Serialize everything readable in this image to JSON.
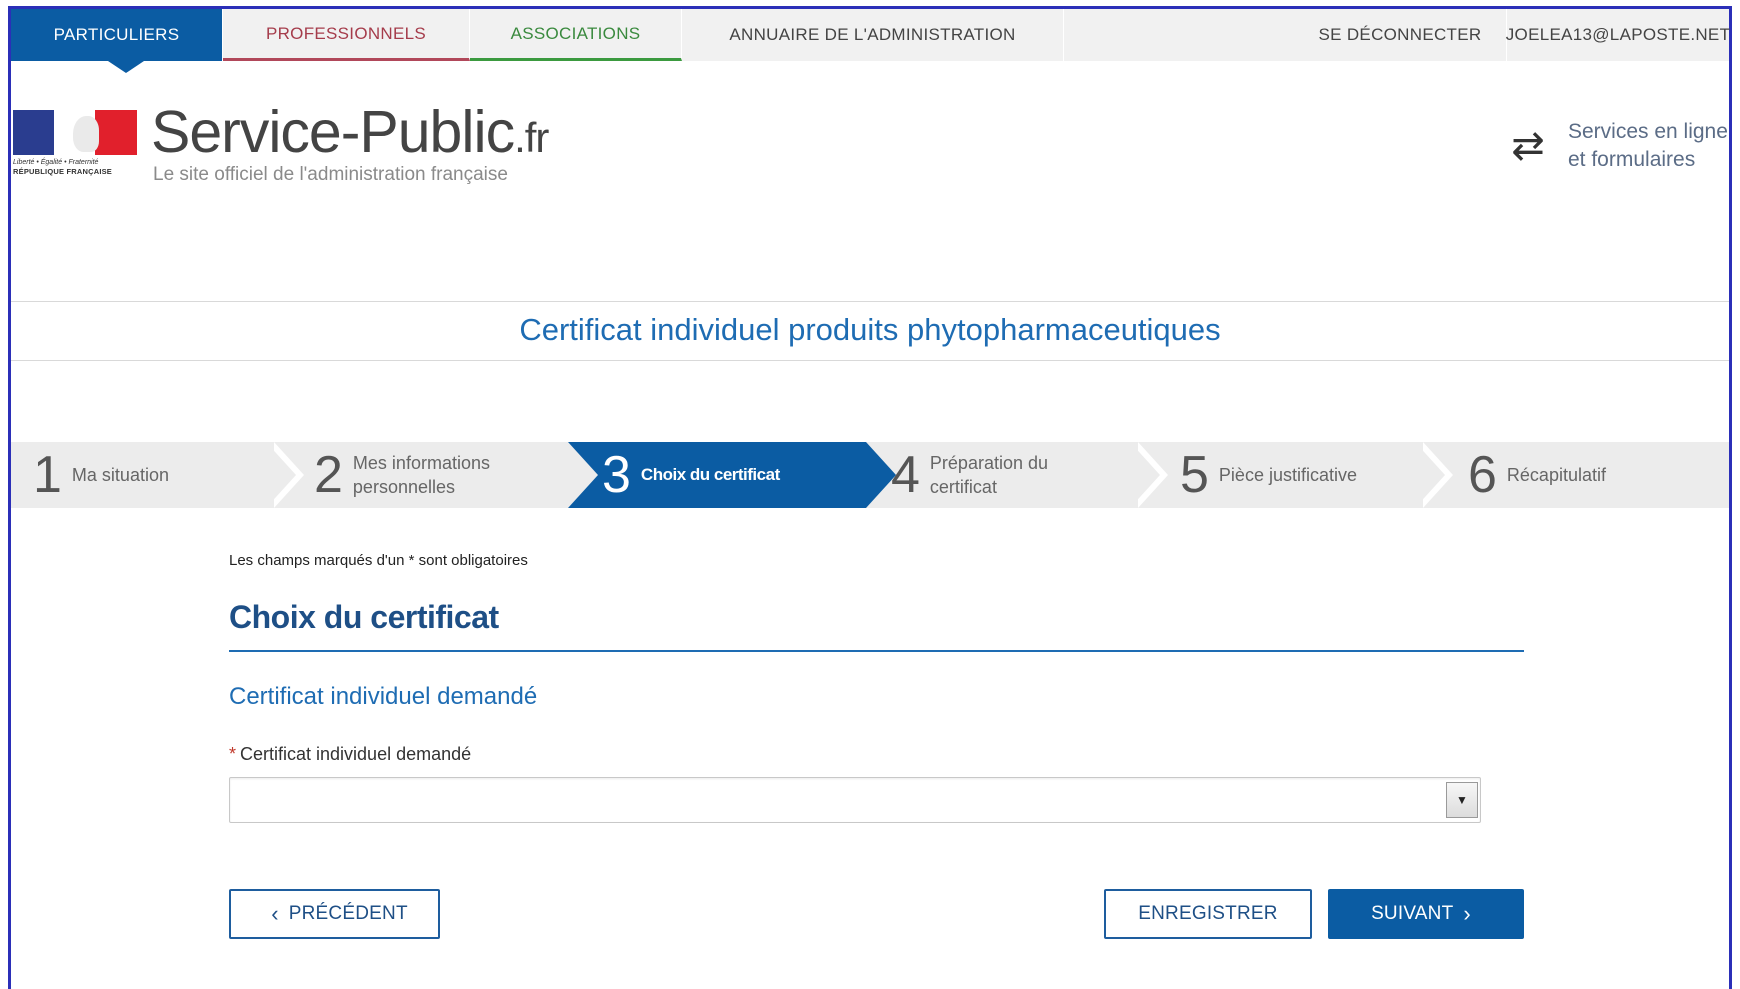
{
  "nav": {
    "particuliers": "PARTICULIERS",
    "professionnels": "PROFESSIONNELS",
    "associations": "ASSOCIATIONS",
    "annuaire": "ANNUAIRE DE L'ADMINISTRATION",
    "logout": "SE DÉCONNECTER",
    "user": "JOELEA13@LAPOSTE.NET"
  },
  "header": {
    "brand": "Service-Public",
    "tld": ".fr",
    "tagline": "Le site officiel de l'administration française",
    "flag_motto": "Liberté • Égalité • Fraternité",
    "flag_rf": "RÉPUBLIQUE FRANÇAISE",
    "services_line1": "Services en ligne",
    "services_line2": "et formulaires"
  },
  "page_title": "Certificat individuel produits phytopharmaceutiques",
  "steps": [
    {
      "num": "1",
      "line1": "Ma situation",
      "line2": ""
    },
    {
      "num": "2",
      "line1": "Mes informations",
      "line2": "personnelles"
    },
    {
      "num": "3",
      "line1": "Choix du certificat",
      "line2": ""
    },
    {
      "num": "4",
      "line1": "Préparation du",
      "line2": "certificat"
    },
    {
      "num": "5",
      "line1": "Pièce justificative",
      "line2": ""
    },
    {
      "num": "6",
      "line1": "Récapitulatif",
      "line2": ""
    }
  ],
  "active_step": 3,
  "form": {
    "required_note": "Les champs marqués d'un * sont obligatoires",
    "section_title": "Choix du certificat",
    "subsection_title": "Certificat individuel demandé",
    "field_star": "*",
    "field_label": "Certificat individuel demandé",
    "field_value": ""
  },
  "buttons": {
    "prev": "PRÉCÉDENT",
    "save": "ENREGISTRER",
    "next": "SUIVANT"
  },
  "colors": {
    "primary_blue": "#0b5ca3",
    "title_blue": "#1e6cb3",
    "pro_red": "#b1485a",
    "asso_green": "#3b9a3f"
  }
}
